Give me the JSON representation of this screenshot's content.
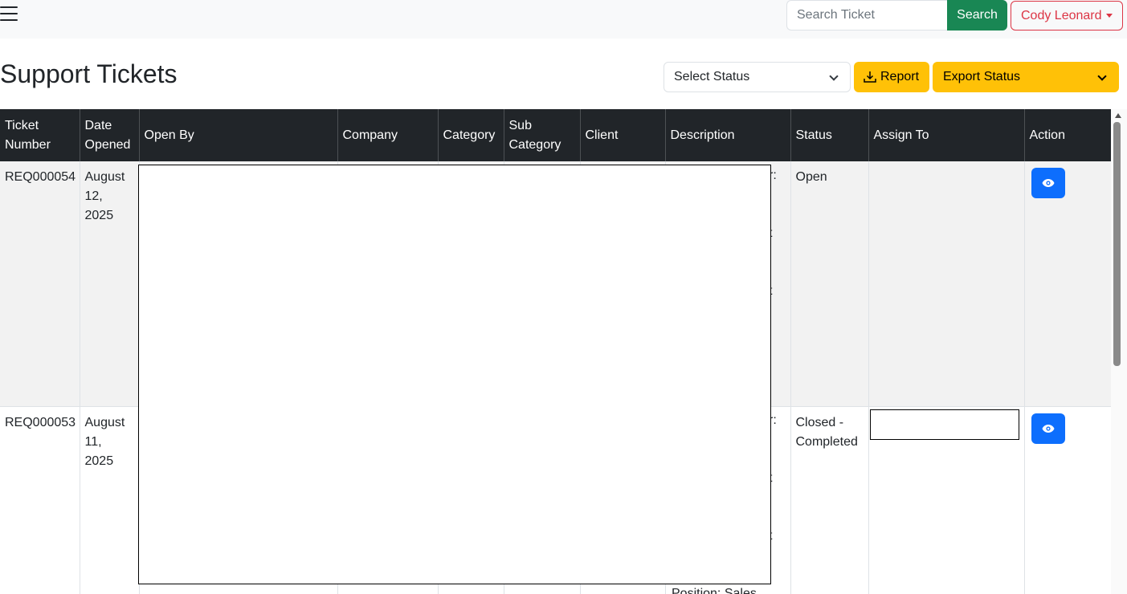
{
  "navbar": {
    "search_placeholder": "Search Ticket",
    "search_label": "Search",
    "user_name": "Cody Leonard"
  },
  "page": {
    "title": "Support Tickets",
    "status_select": "Select Status",
    "report_label": "Report",
    "export_select": "Export Status"
  },
  "table": {
    "headers": {
      "ticket_number": "Ticket Number",
      "date_opened": "Date Opened",
      "open_by": "Open By",
      "company": "Company",
      "category": "Category",
      "sub_category": "Sub Category",
      "client": "Client",
      "description": "Description",
      "status": "Status",
      "assign_to": "Assign To",
      "action": "Action"
    },
    "rows": [
      {
        "ticket_number": "REQ000054",
        "date_opened": "August 12, 2025",
        "status": "Open",
        "desc_fragments": [
          "r:",
          "t",
          "t"
        ]
      },
      {
        "ticket_number": "REQ000053",
        "date_opened": "August 11, 2025",
        "status": "Closed - Completed",
        "desc_fragments": [
          "r:",
          "t",
          "t",
          "Position: Sales"
        ]
      }
    ]
  },
  "colors": {
    "header_bg": "#212529",
    "search_btn": "#198754",
    "user_btn": "#dc3545",
    "warning": "#ffc107",
    "primary": "#0d6efd"
  },
  "icons": [
    "hamburger-icon",
    "chevron-down-icon",
    "download-icon",
    "eye-icon",
    "caret-down-icon"
  ]
}
